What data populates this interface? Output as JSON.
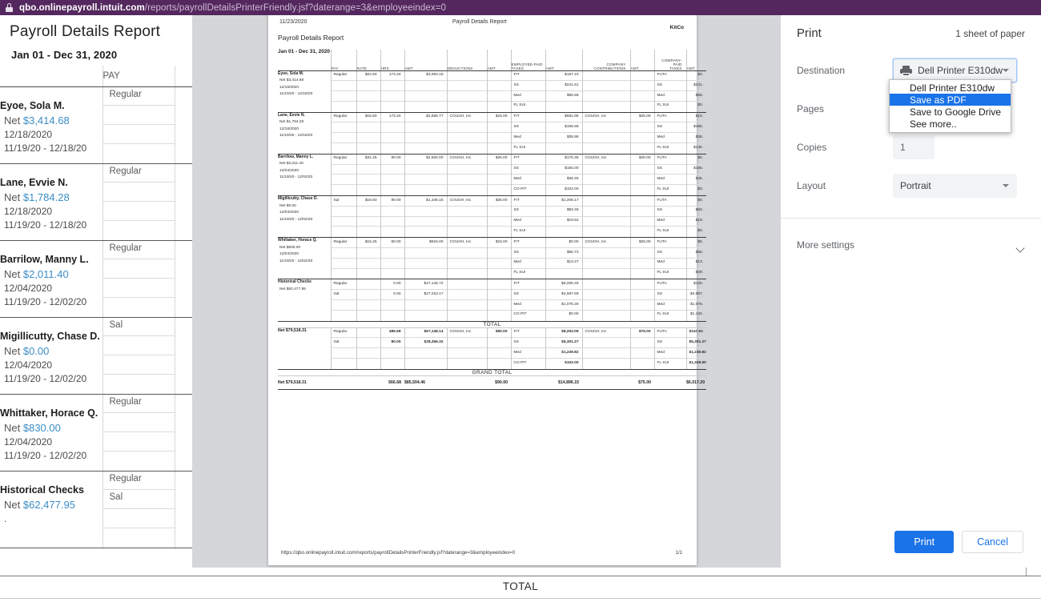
{
  "browser": {
    "lock_icon": "lock-icon",
    "url_host": "qbo.onlinepayroll.intuit.com",
    "url_path": "/reports/payrollDetailsPrinterFriendly.jsf?daterange=3&employeeindex=0"
  },
  "background_report": {
    "title": "Payroll Details Report",
    "date_range": "Jan 01 - Dec 31, 2020",
    "header_pay": "PAY",
    "bottom_total_label": "TOTAL",
    "employees": [
      {
        "name": "Eyoe, Sola M.",
        "net_label": "Net",
        "net_amount": "$3,414.68",
        "check_date": "12/18/2020",
        "period": "11/19/20 -  12/18/20",
        "pay_types": [
          "Regular",
          "",
          "",
          ""
        ]
      },
      {
        "name": "Lane, Evvie N.",
        "net_label": "Net",
        "net_amount": "$1,784.28",
        "check_date": "12/18/2020",
        "period": "11/19/20 -  12/18/20",
        "pay_types": [
          "Regular",
          "",
          "",
          ""
        ]
      },
      {
        "name": "Barrilow, Manny L.",
        "net_label": "Net",
        "net_amount": "$2,011.40",
        "check_date": "12/04/2020",
        "period": "11/19/20 -  12/02/20",
        "pay_types": [
          "Regular",
          "",
          "",
          ""
        ]
      },
      {
        "name": "Migillicutty, Chase D.",
        "net_label": "Net",
        "net_amount": "$0.00",
        "check_date": "12/04/2020",
        "period": "11/19/20 -  12/02/20",
        "pay_types": [
          "Sal",
          "",
          "",
          ""
        ]
      },
      {
        "name": "Whittaker, Horace Q.",
        "net_label": "Net",
        "net_amount": "$830.00",
        "check_date": "12/04/2020",
        "period": "11/19/20 -  12/02/20",
        "pay_types": [
          "Regular",
          "",
          "",
          ""
        ]
      },
      {
        "name": "Historical Checks",
        "net_label": "Net",
        "net_amount": "$62,477.95",
        "check_date": "",
        "period": ".",
        "pay_types": [
          "Regular",
          "Sal",
          "",
          ""
        ]
      }
    ]
  },
  "print_preview": {
    "print_date": "11/23/2020",
    "page_header_title": "Payroll Details Report",
    "report_title": "Payroll Details Report",
    "company_logo": "KitCo",
    "date_range": "Jan 01 - Dec 31, 2020",
    "columns": [
      "",
      "PAY",
      "RATE",
      "HRS",
      "AMT",
      "DEDUCTIONS",
      "AMT",
      "EMPLOYEE-PAID TAXES",
      "AMT",
      "COMPANY CONTRIBUTIONS",
      "AMT",
      "COMPANY-PAID TAXES",
      "AMT"
    ],
    "footer_url": "https://qbo.onlinepayroll.intuit.com/reports/payrollDetailsPrinterFriendly.jsf?daterange=3&employeeindex=0",
    "footer_page": "1/1",
    "total_label": "TOTAL",
    "grand_total_label": "GRAND TOTAL",
    "employees": [
      {
        "name": "Eyoe, Sola M.",
        "net": "Net $3,414.68",
        "check_date": "12/18/2020",
        "period": "11/19/20 -  12/18/20",
        "pay": [
          "Regular",
          "",
          "",
          ""
        ],
        "rate": [
          "$22.50",
          "",
          "",
          ""
        ],
        "hrs": [
          "173.34",
          "",
          "",
          ""
        ],
        "amt1": [
          "$3,900.15",
          "",
          "",
          ""
        ],
        "deductions": [
          "",
          "",
          "",
          ""
        ],
        "amt2": [
          "",
          "",
          "",
          ""
        ],
        "emp_taxes": [
          "FIT",
          "SS",
          "Med",
          "FL SUI"
        ],
        "amt3": [
          "$187.10",
          "$241.81",
          "$56.56",
          ""
        ],
        "contributions": [
          "",
          "",
          "",
          ""
        ],
        "amt4": [
          "",
          "",
          "",
          ""
        ],
        "co_taxes": [
          "FUTA",
          "SS",
          "Med",
          "FL SUI"
        ],
        "amt5": [
          "$0.",
          "$241.",
          "$56.",
          "$0."
        ]
      },
      {
        "name": "Lane, Evvie N.",
        "net": "Net $1,784.28",
        "check_date": "12/18/2020",
        "period": "11/19/20 -  12/18/20",
        "pay": [
          "Regular",
          "",
          "",
          ""
        ],
        "rate": [
          "$15.50",
          "",
          "",
          ""
        ],
        "hrs": [
          "173.34",
          "",
          "",
          ""
        ],
        "amt1": [
          "$2,686.77",
          "",
          "",
          ""
        ],
        "deductions": [
          "COUGH, Inc",
          "",
          "",
          ""
        ],
        "amt2": [
          "$15.00",
          "",
          "",
          ""
        ],
        "emp_taxes": [
          "FIT",
          "SS",
          "Med",
          "FL SUI"
        ],
        "amt3": [
          "$681.95",
          "$166.58",
          "$38.96",
          ""
        ],
        "contributions": [
          "COUGH, Inc",
          "",
          "",
          ""
        ],
        "amt4": [
          "$25.00",
          "",
          "",
          ""
        ],
        "co_taxes": [
          "FUTA",
          "SS",
          "Med",
          "FL SUI"
        ],
        "amt5": [
          "$16.",
          "$166.",
          "$38.",
          "$145."
        ]
      },
      {
        "name": "Barrilow, Manny L.",
        "net": "Net $2,011.40",
        "check_date": "12/04/2020",
        "period": "11/19/20 -  12/02/20",
        "pay": [
          "Regular",
          "",
          "",
          ""
        ],
        "rate": [
          "$31.25",
          "",
          "",
          ""
        ],
        "hrs": [
          "80.00",
          "",
          "",
          ""
        ],
        "amt1": [
          "$2,500.00",
          "",
          "",
          ""
        ],
        "deductions": [
          "COUGH, Inc",
          "",
          "",
          ""
        ],
        "amt2": [
          "$25.00",
          "",
          "",
          ""
        ],
        "emp_taxes": [
          "FIT",
          "SS",
          "Med",
          "CO PIT"
        ],
        "amt3": [
          "$170.35",
          "$155.00",
          "$36.25",
          "$102.00"
        ],
        "contributions": [
          "COUGH, Inc",
          "",
          "",
          ""
        ],
        "amt4": [
          "$25.00",
          "",
          "",
          ""
        ],
        "co_taxes": [
          "FUTA",
          "SS",
          "Med",
          "FL SUI"
        ],
        "amt5": [
          "$0.",
          "$155.",
          "$36.",
          "$0."
        ]
      },
      {
        "name": "Migillicutty, Chase D.",
        "net": "Net $0.00",
        "check_date": "12/04/2020",
        "period": "11/19/20 -  12/02/20",
        "pay": [
          "Sal",
          "",
          "",
          ""
        ],
        "rate": [
          "$16.83",
          "",
          "",
          ""
        ],
        "hrs": [
          "80.00",
          "",
          "",
          ""
        ],
        "amt1": [
          "$1,346.15",
          "",
          "",
          ""
        ],
        "deductions": [
          "COUGH, Inc",
          "",
          "",
          ""
        ],
        "amt2": [
          "$35.00",
          "",
          "",
          ""
        ],
        "emp_taxes": [
          "FIT",
          "SS",
          "Med",
          "FL SUI"
        ],
        "amt3": [
          "$1,208.17",
          "$83.46",
          "$19.52",
          ""
        ],
        "contributions": [
          "",
          "",
          "",
          ""
        ],
        "amt4": [
          "",
          "",
          "",
          ""
        ],
        "co_taxes": [
          "FUTA",
          "SS",
          "Med",
          "FL SUI"
        ],
        "amt5": [
          "$0.",
          "$83.",
          "$19.",
          "$0."
        ]
      },
      {
        "name": "Whittaker, Horace Q.",
        "net": "Net $830.00",
        "check_date": "12/04/2020",
        "period": "11/19/20 -  12/02/20",
        "pay": [
          "Regular",
          "",
          "",
          ""
        ],
        "rate": [
          "$15.25",
          "",
          "",
          ""
        ],
        "hrs": [
          "60.00",
          "",
          "",
          ""
        ],
        "amt1": [
          "$915.00",
          "",
          "",
          ""
        ],
        "deductions": [
          "COUGH, Inc",
          "",
          "",
          ""
        ],
        "amt2": [
          "$15.00",
          "",
          "",
          ""
        ],
        "emp_taxes": [
          "FIT",
          "SS",
          "Med",
          "FL SUI"
        ],
        "amt3": [
          "$0.00",
          "$56.73",
          "$13.27",
          ""
        ],
        "contributions": [
          "COUGH, Inc",
          "",
          "",
          ""
        ],
        "amt4": [
          "$25.00",
          "",
          "",
          ""
        ],
        "co_taxes": [
          "FUTA",
          "SS",
          "Med",
          "FL SUI"
        ],
        "amt5": [
          "$5.",
          "$56.",
          "$13.",
          "$49."
        ]
      },
      {
        "name": "Historical Checks",
        "net": "Net $62,477.95",
        "check_date": "",
        "period": ".",
        "pay": [
          "Regular",
          "Sal",
          "",
          ""
        ],
        "rate": [
          "",
          "",
          "",
          ""
        ],
        "hrs": [
          "0.00",
          "0.00",
          "",
          ""
        ],
        "amt1": [
          "$47,146.72",
          "$27,010.17",
          "",
          ""
        ],
        "deductions": [
          "",
          "",
          "",
          ""
        ],
        "amt2": [
          "",
          "",
          "",
          ""
        ],
        "emp_taxes": [
          "FIT",
          "SS",
          "Med",
          "CO PIT"
        ],
        "amt3": [
          "$6,005.49",
          "$4,597.69",
          "$1,075.26",
          "$0.00"
        ],
        "contributions": [
          "",
          "",
          "",
          ""
        ],
        "amt4": [
          "",
          "",
          "",
          ""
        ],
        "co_taxes": [
          "FUTA",
          "SS",
          "Med",
          "FL SUI"
        ],
        "amt5": [
          "$126.",
          "$4,597.",
          "$1,075.",
          "$1,134."
        ]
      }
    ],
    "total_block": {
      "net": "Net $79,518.31",
      "pay": [
        "Regular",
        "Sal",
        "",
        ""
      ],
      "hrs": [
        "486.68",
        "80.00",
        "",
        ""
      ],
      "amt1": [
        "$57,148.14",
        "$28,356.32",
        "",
        ""
      ],
      "deductions": [
        "COUGH, Inc",
        "",
        "",
        ""
      ],
      "amt2": [
        "$90.00",
        "",
        "",
        ""
      ],
      "emp_taxes": [
        "FIT",
        "SS",
        "Med",
        "CO PIT"
      ],
      "amt3": [
        "$8,253.06",
        "$5,301.27",
        "$1,239.82",
        "$102.00"
      ],
      "contributions": [
        "COUGH, Inc",
        "",
        "",
        ""
      ],
      "amt4": [
        "$75.00",
        "",
        "",
        ""
      ],
      "co_taxes": [
        "FUTA",
        "SS",
        "Med",
        "FL SUI"
      ],
      "amt5": [
        "$147.61",
        "$5,301.27",
        "$1,239.82",
        "$1,328.50"
      ]
    },
    "grand_total": {
      "net": "Net $79,518.31",
      "hrs": "566.68",
      "amt1": "$85,504.46",
      "amt2": "$90.00",
      "amt3": "$14,896.15",
      "amt4": "$75.00",
      "amt5": "$6,017.20"
    }
  },
  "print_dialog": {
    "title": "Print",
    "sheet_summary": "1 sheet of paper",
    "destination_label": "Destination",
    "destination_value": "Dell Printer E310dw",
    "destination_icon": "printer-icon",
    "destination_options": [
      "Dell Printer E310dw",
      "Save as PDF",
      "Save to Google Drive",
      "See more.."
    ],
    "destination_selected_index": 1,
    "pages_label": "Pages",
    "copies_label": "Copies",
    "copies_value": "1",
    "layout_label": "Layout",
    "layout_value": "Portrait",
    "more_settings_label": "More settings",
    "chevron_icon": "chevron-down-icon",
    "print_button": "Print",
    "cancel_button": "Cancel",
    "accent_color": "#1a73e8"
  }
}
